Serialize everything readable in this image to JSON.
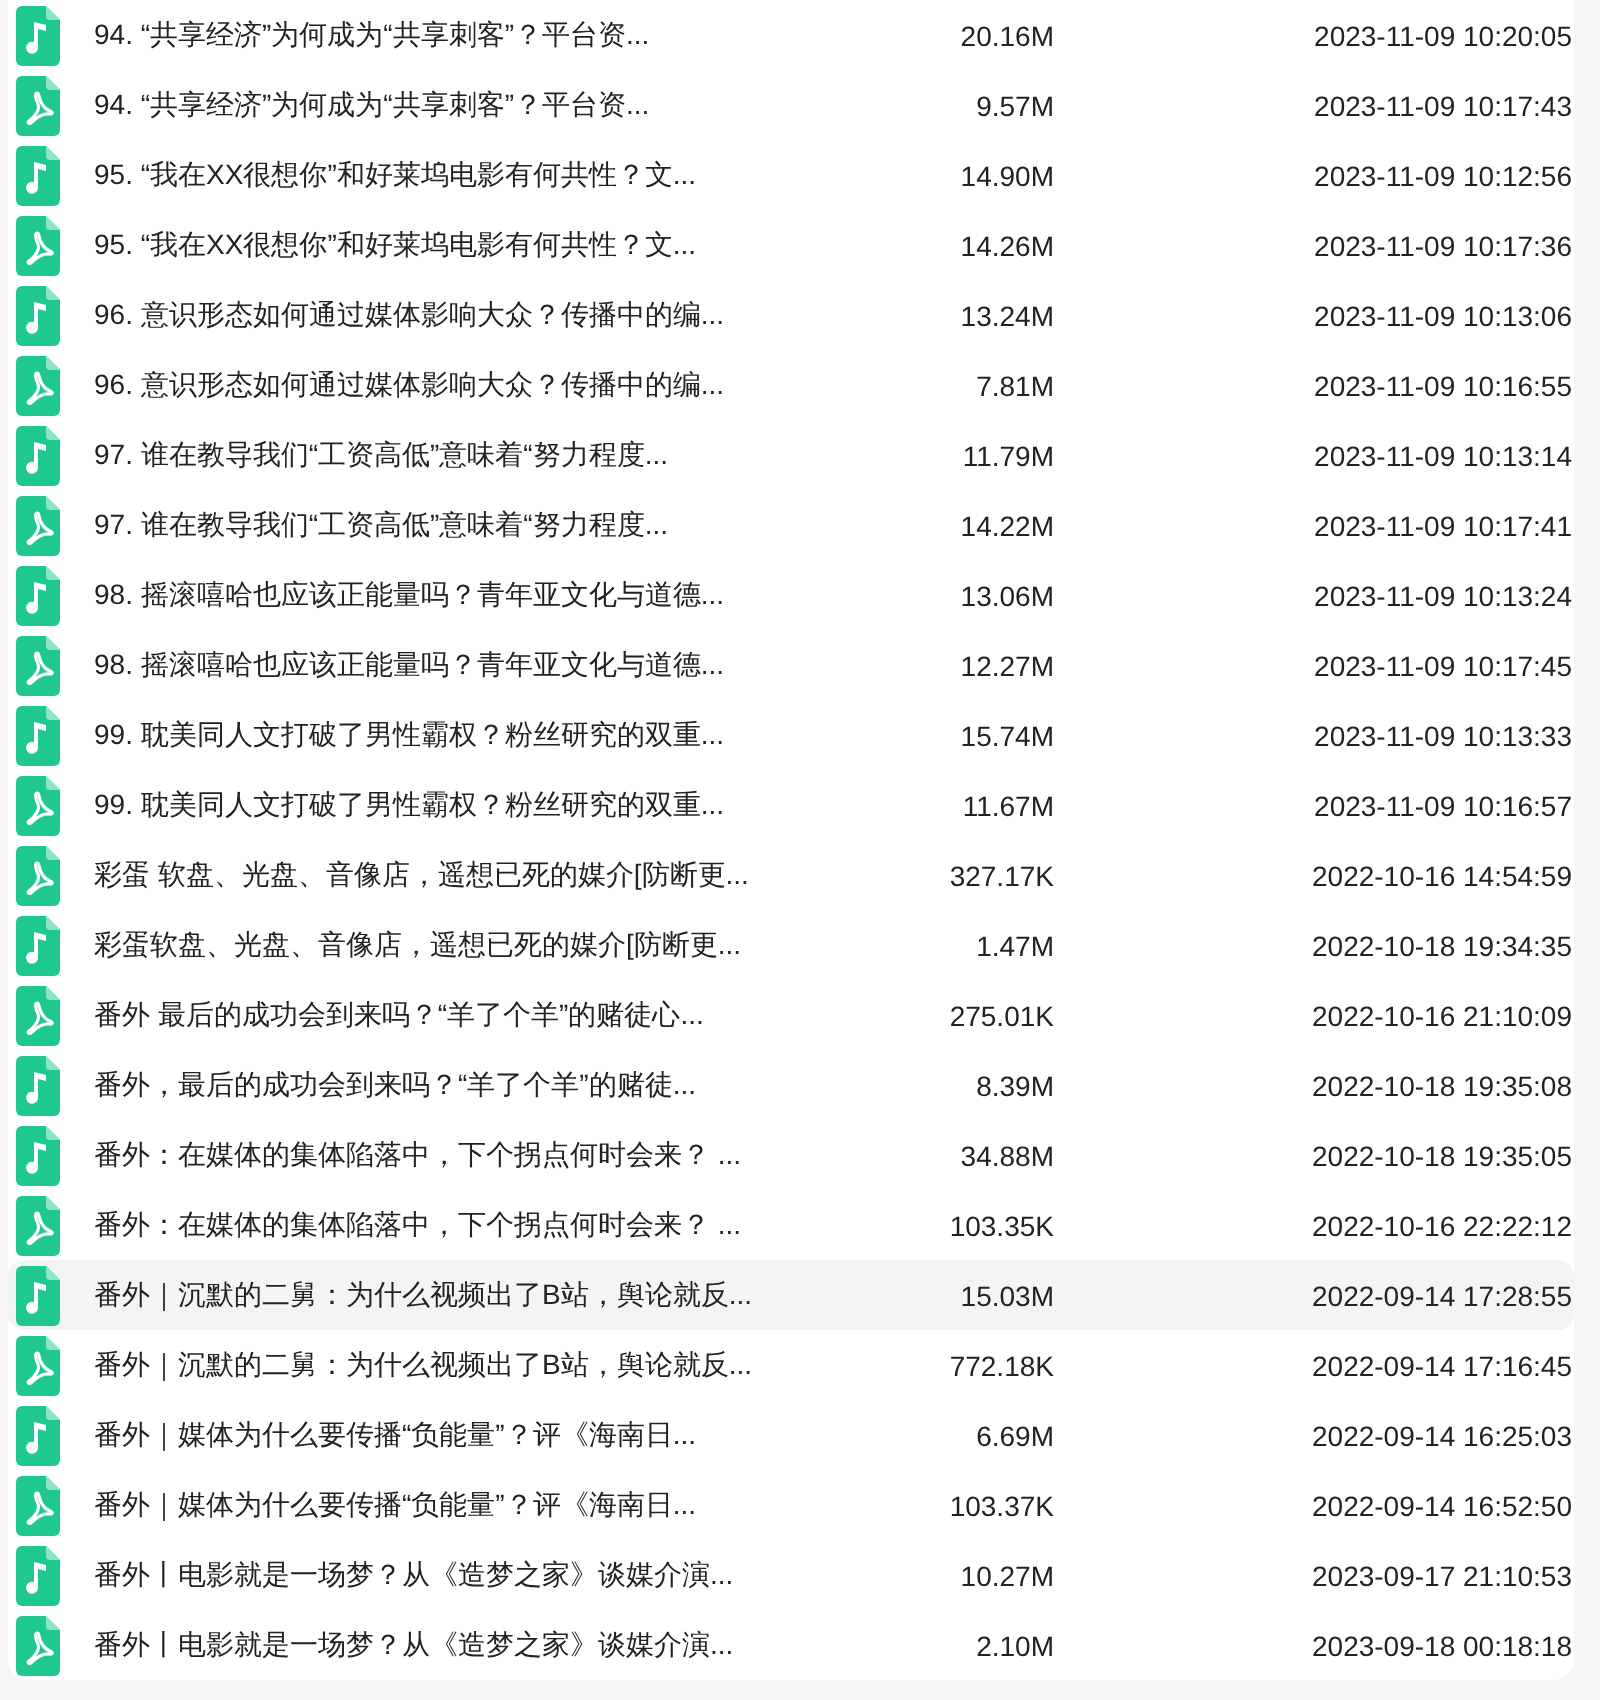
{
  "files": [
    {
      "kind": "audio",
      "name": "94. “共享经济”为何成为“共享刺客”？平台资...",
      "size": "20.16M",
      "modified": "2023-11-09 10:20:05",
      "selected": false
    },
    {
      "kind": "pdf",
      "name": "94. “共享经济”为何成为“共享刺客”？平台资...",
      "size": "9.57M",
      "modified": "2023-11-09 10:17:43",
      "selected": false
    },
    {
      "kind": "audio",
      "name": "95. “我在XX很想你”和好莱坞电影有何共性？文...",
      "size": "14.90M",
      "modified": "2023-11-09 10:12:56",
      "selected": false
    },
    {
      "kind": "pdf",
      "name": "95. “我在XX很想你”和好莱坞电影有何共性？文...",
      "size": "14.26M",
      "modified": "2023-11-09 10:17:36",
      "selected": false
    },
    {
      "kind": "audio",
      "name": "96. 意识形态如何通过媒体影响大众？传播中的编...",
      "size": "13.24M",
      "modified": "2023-11-09 10:13:06",
      "selected": false
    },
    {
      "kind": "pdf",
      "name": "96. 意识形态如何通过媒体影响大众？传播中的编...",
      "size": "7.81M",
      "modified": "2023-11-09 10:16:55",
      "selected": false
    },
    {
      "kind": "audio",
      "name": "97. 谁在教导我们“工资高低”意味着“努力程度...",
      "size": "11.79M",
      "modified": "2023-11-09 10:13:14",
      "selected": false
    },
    {
      "kind": "pdf",
      "name": "97. 谁在教导我们“工资高低”意味着“努力程度...",
      "size": "14.22M",
      "modified": "2023-11-09 10:17:41",
      "selected": false
    },
    {
      "kind": "audio",
      "name": "98. 摇滚嘻哈也应该正能量吗？青年亚文化与道德...",
      "size": "13.06M",
      "modified": "2023-11-09 10:13:24",
      "selected": false
    },
    {
      "kind": "pdf",
      "name": "98. 摇滚嘻哈也应该正能量吗？青年亚文化与道德...",
      "size": "12.27M",
      "modified": "2023-11-09 10:17:45",
      "selected": false
    },
    {
      "kind": "audio",
      "name": "99. 耽美同人文打破了男性霸权？粉丝研究的双重...",
      "size": "15.74M",
      "modified": "2023-11-09 10:13:33",
      "selected": false
    },
    {
      "kind": "pdf",
      "name": "99. 耽美同人文打破了男性霸权？粉丝研究的双重...",
      "size": "11.67M",
      "modified": "2023-11-09 10:16:57",
      "selected": false
    },
    {
      "kind": "pdf",
      "name": "彩蛋 软盘、光盘、音像店，遥想已死的媒介[防断更...",
      "size": "327.17K",
      "modified": "2022-10-16 14:54:59",
      "selected": false
    },
    {
      "kind": "audio",
      "name": "彩蛋软盘、光盘、音像店，遥想已死的媒介[防断更...",
      "size": "1.47M",
      "modified": "2022-10-18 19:34:35",
      "selected": false
    },
    {
      "kind": "pdf",
      "name": "番外 最后的成功会到来吗？“羊了个羊”的赌徒心...",
      "size": "275.01K",
      "modified": "2022-10-16 21:10:09",
      "selected": false
    },
    {
      "kind": "audio",
      "name": "番外，最后的成功会到来吗？“羊了个羊”的赌徒...",
      "size": "8.39M",
      "modified": "2022-10-18 19:35:08",
      "selected": false
    },
    {
      "kind": "audio",
      "name": "番外：在媒体的集体陷落中，下个拐点何时会来？ ...",
      "size": "34.88M",
      "modified": "2022-10-18 19:35:05",
      "selected": false
    },
    {
      "kind": "pdf",
      "name": "番外：在媒体的集体陷落中，下个拐点何时会来？ ...",
      "size": "103.35K",
      "modified": "2022-10-16 22:22:12",
      "selected": false
    },
    {
      "kind": "audio",
      "name": "番外｜沉默的二舅：为什么视频出了B站，舆论就反...",
      "size": "15.03M",
      "modified": "2022-09-14 17:28:55",
      "selected": true
    },
    {
      "kind": "pdf",
      "name": "番外｜沉默的二舅：为什么视频出了B站，舆论就反...",
      "size": "772.18K",
      "modified": "2022-09-14 17:16:45",
      "selected": false
    },
    {
      "kind": "audio",
      "name": "番外｜媒体为什么要传播“负能量”？评《海南日...",
      "size": "6.69M",
      "modified": "2022-09-14 16:25:03",
      "selected": false
    },
    {
      "kind": "pdf",
      "name": "番外｜媒体为什么要传播“负能量”？评《海南日...",
      "size": "103.37K",
      "modified": "2022-09-14 16:52:50",
      "selected": false
    },
    {
      "kind": "audio",
      "name": "番外丨电影就是一场梦？从《造梦之家》谈媒介演...",
      "size": "10.27M",
      "modified": "2023-09-17 21:10:53",
      "selected": false
    },
    {
      "kind": "pdf",
      "name": "番外丨电影就是一场梦？从《造梦之家》谈媒介演...",
      "size": "2.10M",
      "modified": "2023-09-18 00:18:18",
      "selected": false
    }
  ]
}
